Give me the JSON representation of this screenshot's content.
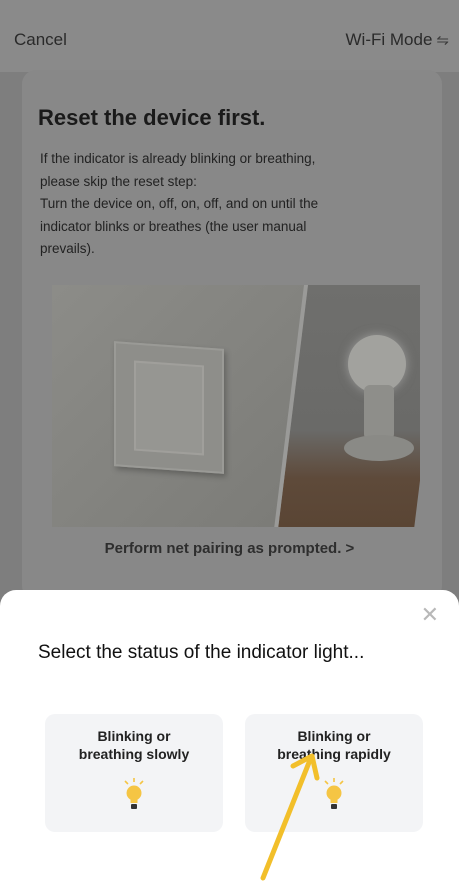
{
  "nav": {
    "cancel": "Cancel",
    "mode": "Wi-Fi Mode",
    "mode_icon": "swap-icon"
  },
  "card": {
    "title": "Reset the device first.",
    "lines": [
      "If the indicator is already blinking or breathing,",
      "please skip the reset step:",
      "Turn the device on, off, on, off, and on until the",
      "indicator blinks or breathes (the user manual",
      "prevails)."
    ],
    "link": "Perform net pairing as prompted. >"
  },
  "sheet": {
    "title": "Select the status of the indicator light...",
    "close_icon": "close-icon",
    "options": [
      {
        "line1": "Blinking or",
        "line2": "breathing slowly"
      },
      {
        "line1": "Blinking or",
        "line2": "breathing rapidly"
      }
    ]
  },
  "colors": {
    "overlay": "#7e7e7e",
    "sheet": "#ffffff",
    "option_bg": "#f3f4f6",
    "bulb": "#f5c544",
    "arrow": "#f2bf2a"
  }
}
